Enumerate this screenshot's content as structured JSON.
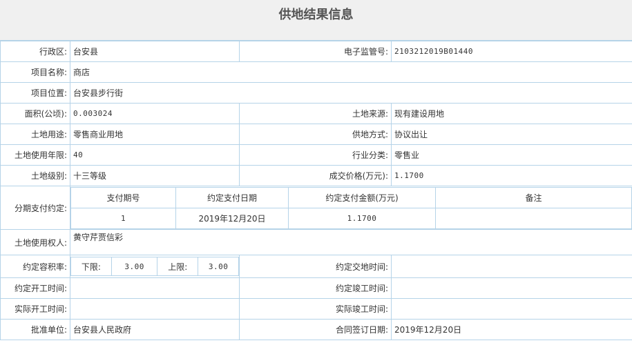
{
  "title": "供地结果信息",
  "labels": {
    "district": "行政区:",
    "supervision_no": "电子监管号:",
    "project_name": "项目名称:",
    "project_location": "项目位置:",
    "area": "面积(公顷):",
    "land_source": "土地来源:",
    "land_use": "土地用途:",
    "supply_method": "供地方式:",
    "use_years": "土地使用年限:",
    "industry": "行业分类:",
    "land_grade": "土地级别:",
    "price": "成交价格(万元):",
    "installments": "分期支付约定:",
    "land_user": "土地使用权人:",
    "far": "约定容积率:",
    "handover_time": "约定交地时间:",
    "planned_start": "约定开工时间:",
    "planned_finish": "约定竣工时间:",
    "actual_start": "实际开工时间:",
    "actual_finish": "实际竣工时间:",
    "approval_unit": "批准单位:",
    "contract_date": "合同签订日期:"
  },
  "values": {
    "district": "台安县",
    "supervision_no": "2103212019B01440",
    "project_name": "商店",
    "project_location": "台安县步行街",
    "area": "0.003024",
    "land_source": "现有建设用地",
    "land_use": "零售商业用地",
    "supply_method": "协议出让",
    "use_years": "40",
    "industry": "零售业",
    "land_grade": "十三等级",
    "price": "1.1700",
    "land_user": "黄守芹贾信彩",
    "handover_time": "",
    "planned_start": "",
    "planned_finish": "",
    "actual_start": "",
    "actual_finish": "",
    "approval_unit": "台安县人民政府",
    "contract_date": "2019年12月20日"
  },
  "installment_table": {
    "headers": [
      "支付期号",
      "约定支付日期",
      "约定支付金额(万元)",
      "备注"
    ],
    "rows": [
      [
        "1",
        "2019年12月20日",
        "1.1700",
        ""
      ]
    ]
  },
  "far": {
    "lower_label": "下限:",
    "lower_value": "3.00",
    "upper_label": "上限:",
    "upper_value": "3.00"
  }
}
